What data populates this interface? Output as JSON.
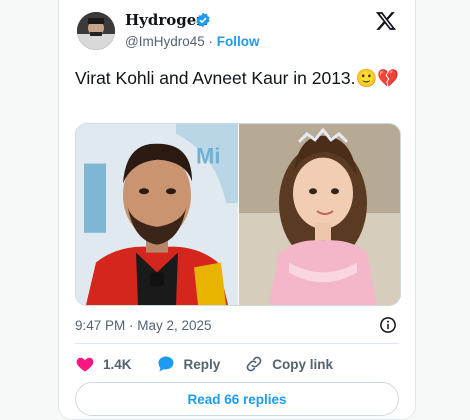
{
  "author": {
    "name": "Hydrogen",
    "handle": "@ImHydro45",
    "separator": "·",
    "follow_label": "Follow",
    "verified_icon": "verified-badge-icon"
  },
  "tweet": {
    "text": "Virat Kohli and Avneet Kaur in 2013.🙂💔",
    "timestamp": "9:47 PM · May 2, 2025"
  },
  "media": {
    "left_photo": "photo-of-man-in-red-jersey",
    "right_photo": "photo-of-girl-with-tiara"
  },
  "actions": {
    "likes_count": "1.4K",
    "reply_label": "Reply",
    "copy_link_label": "Copy link"
  },
  "read_replies_label": "Read 66 replies",
  "colors": {
    "accent": "#1d9bf0",
    "heart": "#f91880",
    "text": "#0f1419",
    "muted": "#536471"
  }
}
